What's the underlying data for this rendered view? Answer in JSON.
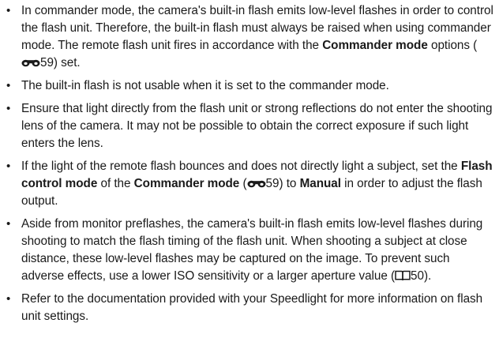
{
  "notes": [
    {
      "parts": [
        "In commander mode, the camera's built-in flash emits low-level flashes in order to control the flash unit. Therefore, the built-in flash must always be raised when using commander mode. The remote flash unit fires in accordance with the ",
        "Commander mode",
        " options (",
        "59",
        ") set."
      ]
    },
    {
      "parts": [
        "The built-in flash is not usable when it is set to the commander mode."
      ]
    },
    {
      "parts": [
        "Ensure that light directly from the flash unit or strong reflections do not enter the shooting lens of the camera. It may not be possible to obtain the correct exposure if such light enters the lens."
      ]
    },
    {
      "parts": [
        "If the light of the remote flash bounces and does not directly light a subject, set the ",
        "Flash control mode",
        " of the ",
        "Commander mode",
        " (",
        "59",
        ") to ",
        "Manual",
        " in order to adjust the flash output."
      ]
    },
    {
      "parts": [
        "Aside from monitor preflashes, the camera's built-in flash emits low-level flashes during shooting to match the flash timing of the flash unit. When shooting a subject at close distance, these low-level flashes may be captured on the image. To prevent such adverse effects, use a lower ISO sensitivity or a larger aperture value (",
        "50",
        ")."
      ]
    },
    {
      "parts": [
        "Refer to the documentation provided with your Speedlight for more information on flash unit settings."
      ]
    }
  ],
  "icons": {
    "reference": "reference-section-icon",
    "book": "book-page-icon"
  }
}
